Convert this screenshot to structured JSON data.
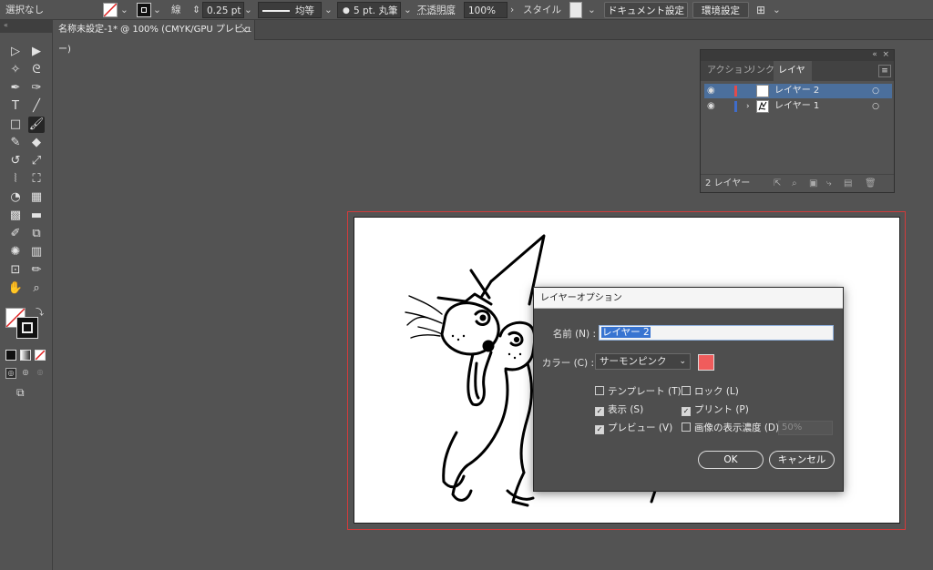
{
  "control_bar": {
    "selection": "選択なし",
    "stroke_label": "線",
    "stroke_weight": "0.25 pt",
    "profile": "均等",
    "brush": "5 pt. 丸筆",
    "opacity_label": "不透明度",
    "opacity_value": "100%",
    "style_label": "スタイル",
    "doc_setup_button": "ドキュメント設定",
    "prefs_button": "環境設定"
  },
  "document_tab": {
    "title": "名称未設定-1* @ 100% (CMYK/GPU プレビュー)",
    "close": "×"
  },
  "layers_panel": {
    "tabs": [
      "アクション",
      "リンク",
      "レイヤー"
    ],
    "active_tab": "レイヤー",
    "layers": [
      {
        "name": "レイヤー 2",
        "color": "#e34b4b",
        "selected": true
      },
      {
        "name": "レイヤー 1",
        "color": "#3f6cc9",
        "selected": false
      }
    ],
    "footer_count": "2 レイヤー"
  },
  "dialog": {
    "title": "レイヤーオプション",
    "name_label": "名前 (N) :",
    "name_value": "レイヤー 2",
    "color_label": "カラー (C) :",
    "color_value": "サーモンピンク",
    "color_hex": "#f05c5c",
    "checkboxes": {
      "template": {
        "label": "テンプレート (T)",
        "checked": false
      },
      "lock": {
        "label": "ロック (L)",
        "checked": false
      },
      "show": {
        "label": "表示 (S)",
        "checked": true
      },
      "print": {
        "label": "プリント (P)",
        "checked": true
      },
      "preview": {
        "label": "プレビュー (V)",
        "checked": true
      },
      "dim": {
        "label": "画像の表示濃度 (D) :",
        "checked": false
      }
    },
    "dim_value": "50%",
    "ok_label": "OK",
    "cancel_label": "キャンセル"
  },
  "tools": [
    "selection-tool",
    "direct-selection-tool",
    "magic-wand-tool",
    "lasso-tool",
    "pen-tool",
    "curvature-tool",
    "type-tool",
    "line-tool",
    "rectangle-tool",
    "paintbrush-tool",
    "shaper-tool",
    "eraser-tool",
    "rotate-tool",
    "scale-tool",
    "width-tool",
    "free-transform-tool",
    "shape-builder-tool",
    "perspective-grid-tool",
    "mesh-tool",
    "gradient-tool",
    "eyedropper-tool",
    "blend-tool",
    "symbol-sprayer-tool",
    "graph-tool",
    "artboard-tool",
    "slice-tool",
    "hand-tool",
    "zoom-tool"
  ]
}
